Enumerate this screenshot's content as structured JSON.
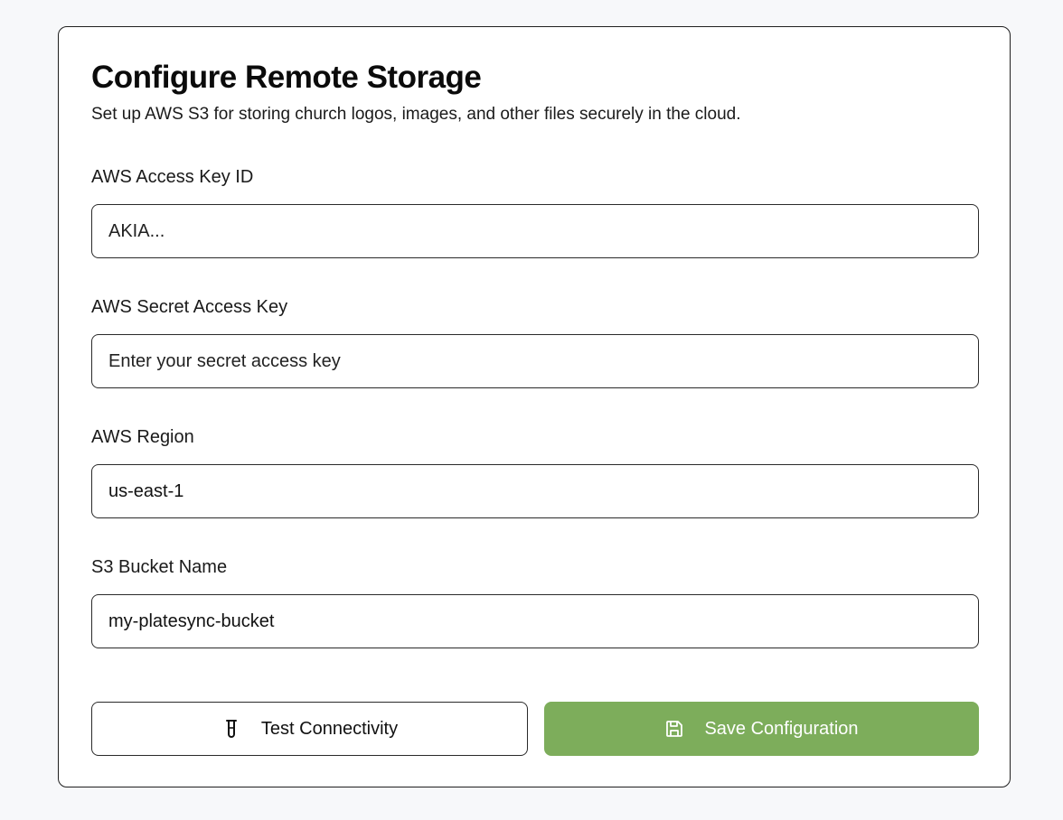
{
  "card": {
    "title": "Configure Remote Storage",
    "subtitle": "Set up AWS S3 for storing church logos, images, and other files securely in the cloud."
  },
  "fields": {
    "access_key": {
      "label": "AWS Access Key ID",
      "value": "",
      "placeholder": "AKIA..."
    },
    "secret_key": {
      "label": "AWS Secret Access Key",
      "value": "",
      "placeholder": "Enter your secret access key"
    },
    "region": {
      "label": "AWS Region",
      "value": "us-east-1",
      "placeholder": ""
    },
    "bucket": {
      "label": "S3 Bucket Name",
      "value": "my-platesync-bucket",
      "placeholder": ""
    }
  },
  "actions": {
    "test_label": "Test Connectivity",
    "test_icon": "test-tube-icon",
    "save_label": "Save Configuration",
    "save_icon": "save-icon"
  },
  "colors": {
    "accent": "#7dad5b",
    "page_background": "#f7f8fa",
    "border": "#1f1f1f"
  }
}
